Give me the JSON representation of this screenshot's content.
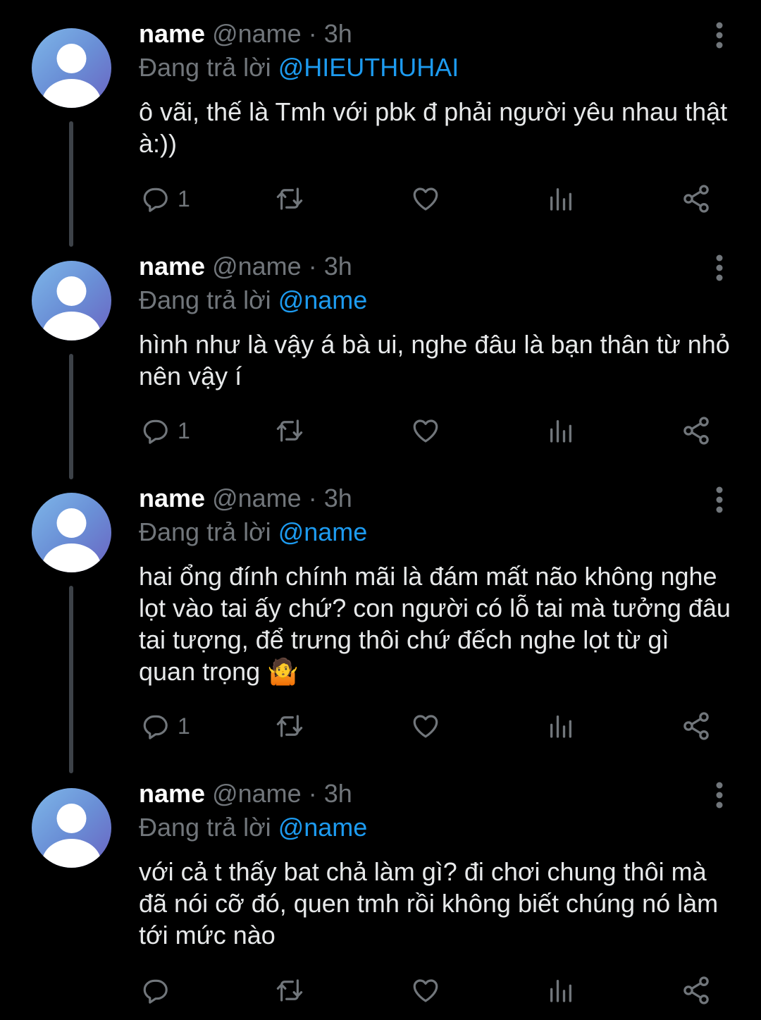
{
  "tweets": [
    {
      "name": "name",
      "handle": "@name",
      "separator": "·",
      "time": "3h",
      "reply_prefix": "Đang trả lời",
      "reply_to": "@HIEUTHUHAI",
      "text": "ô vãi, thế là Tmh với pbk đ phải người yêu nhau thật à:))",
      "reply_count": "1"
    },
    {
      "name": "name",
      "handle": "@name",
      "separator": "·",
      "time": "3h",
      "reply_prefix": "Đang trả lời",
      "reply_to": "@name",
      "text": "hình như là vậy á bà ui, nghe đâu là bạn thân từ nhỏ nên vậy í",
      "reply_count": "1"
    },
    {
      "name": "name",
      "handle": "@name",
      "separator": "·",
      "time": "3h",
      "reply_prefix": "Đang trả lời",
      "reply_to": "@name",
      "text": "hai ổng đính chính mãi là đám mất não không nghe lọt vào tai ấy chứ? con người có lỗ tai mà tưởng đâu tai tượng, để trưng thôi chứ đếch nghe lọt từ gì quan trọng 🤷",
      "reply_count": "1"
    },
    {
      "name": "name",
      "handle": "@name",
      "separator": "·",
      "time": "3h",
      "reply_prefix": "Đang trả lời",
      "reply_to": "@name",
      "text": "với cả t thấy bat chả làm gì? đi chơi chung thôi mà đã nói cỡ đó, quen tmh rồi không biết chúng nó làm tới mức nào",
      "reply_count": ""
    }
  ],
  "icons": {
    "reply": "reply-icon",
    "retweet": "retweet-icon",
    "like": "heart-icon",
    "views": "views-icon",
    "share": "share-icon",
    "more": "more-vertical-icon"
  },
  "colors": {
    "background": "#000000",
    "name": "#ffffff",
    "muted": "#71767b",
    "mention": "#1d9bf0",
    "body_text": "#e7e9ea",
    "thread_line": "#3d4248"
  }
}
